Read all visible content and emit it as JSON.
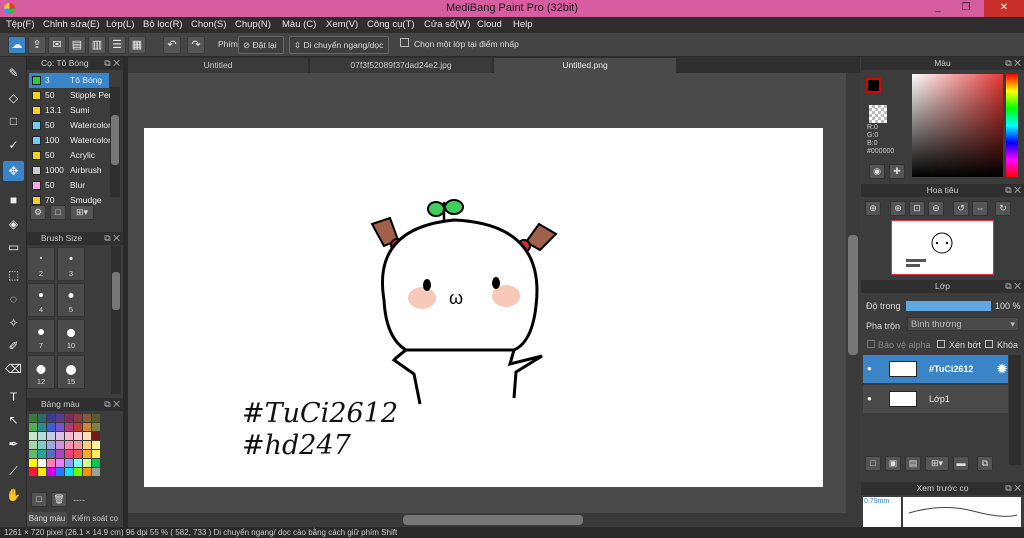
{
  "window": {
    "title": "MediBang Paint Pro (32bit)",
    "controls": [
      "_",
      "❐",
      "✕"
    ]
  },
  "menu": [
    "Tệp(F)",
    "Chỉnh sửa(E)",
    "Lớp(L)",
    "Bộ lọc(R)",
    "Chọn(S)",
    "Chụp(N)",
    "Màu (C)",
    "Xem(V)",
    "Công cụ(T)",
    "Cửa sổ(W)",
    "Cloud",
    "Help"
  ],
  "toolbar": {
    "phim_label": "Phím",
    "reset_label": "Đặt lại",
    "move_label": "Di chuyển ngang/dọc",
    "select_layer_label": "Chọn một lớp tại điểm nhấp"
  },
  "tabs": [
    "Untitled",
    "07f3f52089f37dad24e2.jpg",
    "Untitled.png"
  ],
  "brush_panel": {
    "title": "Cọ: Tô Bóng",
    "items": [
      {
        "size": "3",
        "name": "Tô Bóng",
        "color": "#2ecc40",
        "selected": true
      },
      {
        "size": "50",
        "name": "Stipple Pen",
        "color": "#f1d21c"
      },
      {
        "size": "13.1",
        "name": "Sumi",
        "color": "#f1d21c"
      },
      {
        "size": "50",
        "name": "Watercolor",
        "color": "#6ccff6"
      },
      {
        "size": "100",
        "name": "Watercolor",
        "color": "#6ccff6"
      },
      {
        "size": "50",
        "name": "Acrylic",
        "color": "#f1d21c"
      },
      {
        "size": "1000",
        "name": "Airbrush",
        "color": "#cccccc"
      },
      {
        "size": "50",
        "name": "Blur",
        "color": "#f4a6e6"
      },
      {
        "size": "70",
        "name": "Smudge",
        "color": "#f1d21c"
      }
    ]
  },
  "brush_size_panel": {
    "title": "Brush Size",
    "sizes": [
      "2",
      "3",
      "4",
      "5",
      "7",
      "10",
      "12",
      "15"
    ]
  },
  "palette_panel": {
    "title": "Bảng màu",
    "colors": [
      "#3a7a3a",
      "#2d6a6a",
      "#3c3c8c",
      "#5a3c8c",
      "#7a2d5a",
      "#8c3c3c",
      "#8c5a2d",
      "#5a5a2d",
      "#4caf50",
      "#2e8b8b",
      "#3a5fcd",
      "#7b52c7",
      "#b03a7a",
      "#c0392b",
      "#d4842d",
      "#808040",
      "#c8e6c9",
      "#b2dfdb",
      "#c5cae9",
      "#e1bee7",
      "#f8bbd0",
      "#ffcdd2",
      "#ffe0b2",
      "#6d1b1b",
      "#a5d6a7",
      "#80cbc4",
      "#9fa8da",
      "#ce93d8",
      "#f48fb1",
      "#ef9a9a",
      "#ffcc80",
      "#fff59d",
      "#66bb6a",
      "#26a69a",
      "#5c6bc0",
      "#ab47bc",
      "#ec407a",
      "#ef5350",
      "#ffa726",
      "#ffee58",
      "#ffff00",
      "#ffffff",
      "#ff80ab",
      "#ea80fc",
      "#8c9eff",
      "#84ffff",
      "#ccff90",
      "#00c853",
      "#ff1744",
      "#ffea00",
      "#d500f9",
      "#2979ff",
      "#00e5ff",
      "#76ff03",
      "#ff9100",
      "#9e9e9e"
    ],
    "tabs": [
      "Bảng màu",
      "Kiểm soát cọ"
    ],
    "extra": "----"
  },
  "color_panel": {
    "title": "Màu",
    "rgb": [
      "R:0",
      "G:0",
      "B:0"
    ],
    "hex": "#000000",
    "fg_color": "#000000",
    "bg_color": "#ffffff"
  },
  "navigator_panel": {
    "title": "Hoa tiêu"
  },
  "layer_panel": {
    "title": "Lớp",
    "opacity_label": "Độ trong",
    "opacity_value": "100 %",
    "opacity_fraction": 1.0,
    "blend_label": "Pha trộn",
    "blend_value": "Bình thường",
    "protect_alpha": "Bảo vệ alpha",
    "clipping": "Xén bớt",
    "lock": "Khóa",
    "layers": [
      {
        "name": "#TuCi2612",
        "selected": true
      },
      {
        "name": "Lớp1",
        "selected": false
      }
    ]
  },
  "preview_panel": {
    "title": "Xem trước cọ",
    "size_label": "0.79mm"
  },
  "canvas": {
    "text_line1": "#TuCi2612",
    "text_line2": "#hd247"
  },
  "status": "1261 × 720 pixel  (26.1 × 14.9 cm)  96 dpi  55 %  ( 582, 733 )  Di chuyển ngang/ dọc cào bằng cách giữ phím Shift"
}
